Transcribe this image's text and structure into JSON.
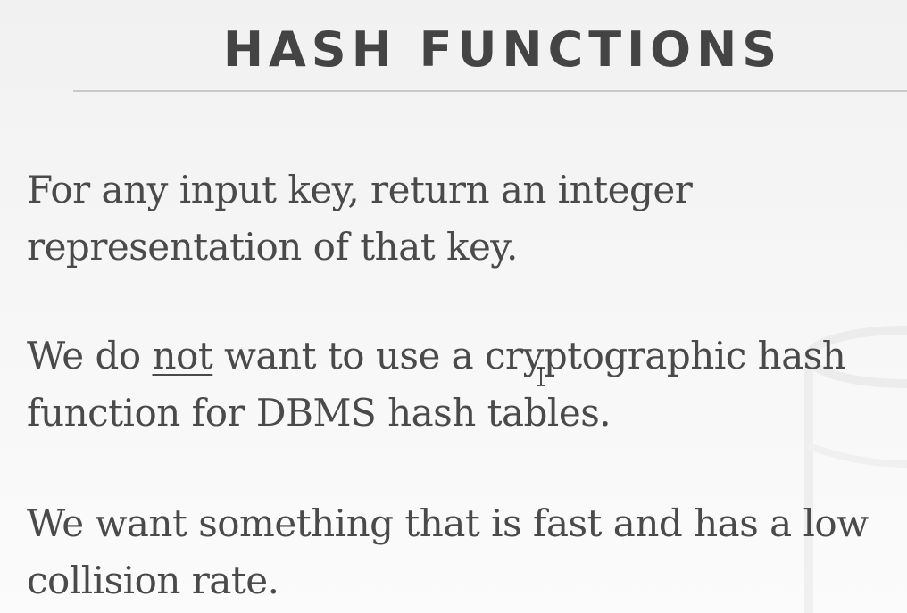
{
  "slide": {
    "title": "HASH FUNCTIONS",
    "paragraphs": [
      {
        "lines": [
          "For any input key, return an integer",
          "representation of that key."
        ]
      },
      {
        "line1_before": "We do ",
        "line1_underlined": "not",
        "line1_after": " want to use a cryptographic hash",
        "line2": "function for DBMS hash tables."
      },
      {
        "lines": [
          "We want something that is fast and has a low",
          "collision rate."
        ]
      }
    ]
  },
  "icons": {
    "cursor": "text-cursor-icon",
    "watermark": "database-icon"
  },
  "colors": {
    "title": "#444444",
    "text": "#4a4a4a",
    "rule": "#c9c9c9",
    "background": "#f3f3f3"
  }
}
